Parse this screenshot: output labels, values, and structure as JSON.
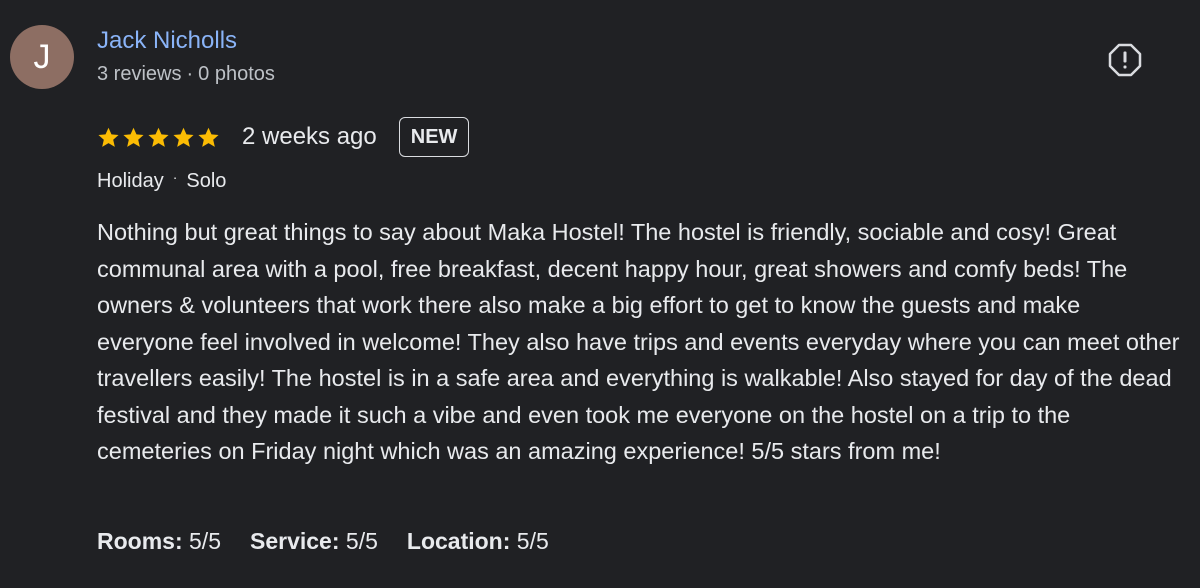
{
  "author": {
    "initial": "J",
    "name": "Jack Nicholls",
    "reviews": "3 reviews",
    "separator": "·",
    "photos": "0 photos"
  },
  "review": {
    "stars": 5,
    "time_ago": "2 weeks ago",
    "badge": "NEW",
    "trip_type": "Holiday",
    "trip_dot": "·",
    "trip_company": "Solo",
    "text": "Nothing but great things to say about Maka Hostel! The hostel is friendly, sociable and cosy! Great communal area with a pool, free breakfast, decent happy hour, great showers and comfy beds! The owners & volunteers that work there also make a big effort to get to know the guests and make everyone feel involved in welcome! They also have trips and events everyday where you can meet other travellers easily! The hostel is in a safe area and everything is walkable! Also stayed for day of the dead festival and they made it such a vibe and even took me everyone on the hostel on a trip to the cemeteries on Friday night which was an amazing experience! 5/5 stars from me!"
  },
  "ratings": {
    "rooms": {
      "label": "Rooms:",
      "value": "5/5"
    },
    "service": {
      "label": "Service:",
      "value": "5/5"
    },
    "location": {
      "label": "Location:",
      "value": "5/5"
    }
  },
  "icons": {
    "report": "report-flag-icon",
    "star": "star-icon"
  },
  "colors": {
    "background": "#202124",
    "author_name": "#8ab4f8",
    "avatar": "#8d6e63",
    "star": "#fbbc04",
    "text": "#e8eaed",
    "meta": "#bdc1c6"
  }
}
